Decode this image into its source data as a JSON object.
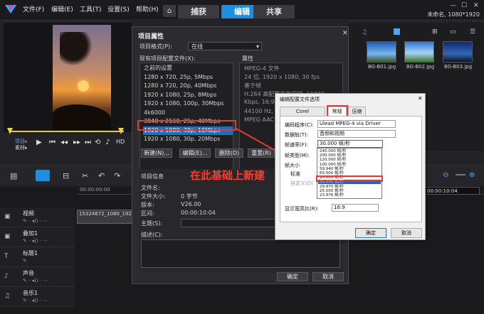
{
  "menu": {
    "file": "文件(F)",
    "edit": "编辑(E)",
    "tools": "工具(T)",
    "settings": "设置(S)",
    "help": "帮助(H)"
  },
  "tabs": [
    {
      "label": "捕获"
    },
    {
      "label": "编辑"
    },
    {
      "label": "共享"
    }
  ],
  "window": {
    "project_name": "未命名, 1080*1920",
    "minimize": "—",
    "maximize": "☐",
    "close": "✕"
  },
  "preview": {
    "project_label": "项目▸",
    "material_label": "素材▸",
    "hd_label": "HD"
  },
  "library": {
    "thumbs": [
      {
        "label": "BG-B01.jpg"
      },
      {
        "label": "BG-B02.jpg"
      },
      {
        "label": "BG-B03.jpg"
      }
    ]
  },
  "timeline": {
    "timecode": "00:00:10:04",
    "clip_name": "15324672_1080_1920",
    "ruler_start": "00:00:00:00",
    "tracks": [
      {
        "name": "视频"
      },
      {
        "name": "叠加1"
      },
      {
        "name": "标题1"
      },
      {
        "name": "声音"
      },
      {
        "name": "音乐1"
      }
    ]
  },
  "project_dialog": {
    "title": "项目属性",
    "format_label": "项目格式(P):",
    "format_value": "在线",
    "profiles_label": "现有项目配置文件(X):",
    "props_label": "属性",
    "profiles": [
      {
        "label": "之前的设置"
      },
      {
        "label": "1280 x 720, 25p, 5Mbps"
      },
      {
        "label": "1280 x 720, 20p, 40Mbps"
      },
      {
        "label": "1920 x 1080, 25p, 8Mbps"
      },
      {
        "label": "1920 x 1080, 100p, 30Mbps"
      },
      {
        "label": "4k6000"
      },
      {
        "label": "3840 x 2160, 25p, 40Mbps"
      },
      {
        "label": "1920 x 1080, 30p, 10Mbps"
      },
      {
        "label": "1920 x 1080, 30p, 20Mbps"
      }
    ],
    "props": [
      {
        "text": "MPEG-4 文件"
      },
      {
        "text": "24 位, 1920 x 1080, 30 fps"
      },
      {
        "text": "基于帧"
      },
      {
        "text": "H.264 高配置文件视频: 10000"
      },
      {
        "text": "Kbps, 16:9"
      },
      {
        "text": "44100 Hz, 16 位"
      },
      {
        "text": "MPEG AAC 音频"
      }
    ],
    "new_btn": "新建(N)...",
    "edit_btn": "编辑(E)...",
    "delete_btn": "删除(D)",
    "reset_btn": "重置(R)",
    "info_label": "项目信息",
    "info": [
      {
        "label": "文件名:",
        "value": ""
      },
      {
        "label": "文件大小:",
        "value": "0 字节"
      },
      {
        "label": "版本:",
        "value": "V26.00"
      },
      {
        "label": "区间:",
        "value": "00:00:10:04"
      },
      {
        "label": "主题(S):",
        "value": ""
      },
      {
        "label": "描述(C):",
        "value": ""
      }
    ],
    "ok": "确定",
    "cancel": "取消",
    "annotation": "在此基础上新建"
  },
  "options_dialog": {
    "title": "编辑配置文件选项",
    "tabs": [
      {
        "label": "Corel VideoStudio"
      },
      {
        "label": "常规"
      },
      {
        "label": "压缩"
      }
    ],
    "codec_label": "编码程序(C):",
    "codec_value": "Ulead MPEG-4 via Driver",
    "datatrack_label": "数据轨(T):",
    "datatrack_value": "音频和视频",
    "framerate_label": "帧速率(F):",
    "framerate_value": "30.000 帧/秒",
    "frametype_label": "帧类型(M):",
    "framesize_label": "帧大小",
    "standard_label": "标准",
    "custom_label": "自定义(D)",
    "aspect_label": "显示宽高比(R):",
    "aspect_value": "16:9",
    "framerates": [
      {
        "label": "240.000 帧/秒"
      },
      {
        "label": "200.000 帧/秒"
      },
      {
        "label": "120.000 帧/秒"
      },
      {
        "label": "100.000 帧/秒"
      },
      {
        "label": "59.940 帧/秒"
      },
      {
        "label": "60.000 帧/秒"
      },
      {
        "label": "50.000 帧/秒"
      },
      {
        "label": "30.000 帧/秒"
      },
      {
        "label": "29.970 帧/秒"
      },
      {
        "label": "25.000 帧/秒"
      },
      {
        "label": "23.976 帧/秒"
      }
    ],
    "ok": "确定",
    "cancel": "取消"
  },
  "colors": {
    "accent": "#1d8fe3",
    "highlight": "#e53935"
  }
}
